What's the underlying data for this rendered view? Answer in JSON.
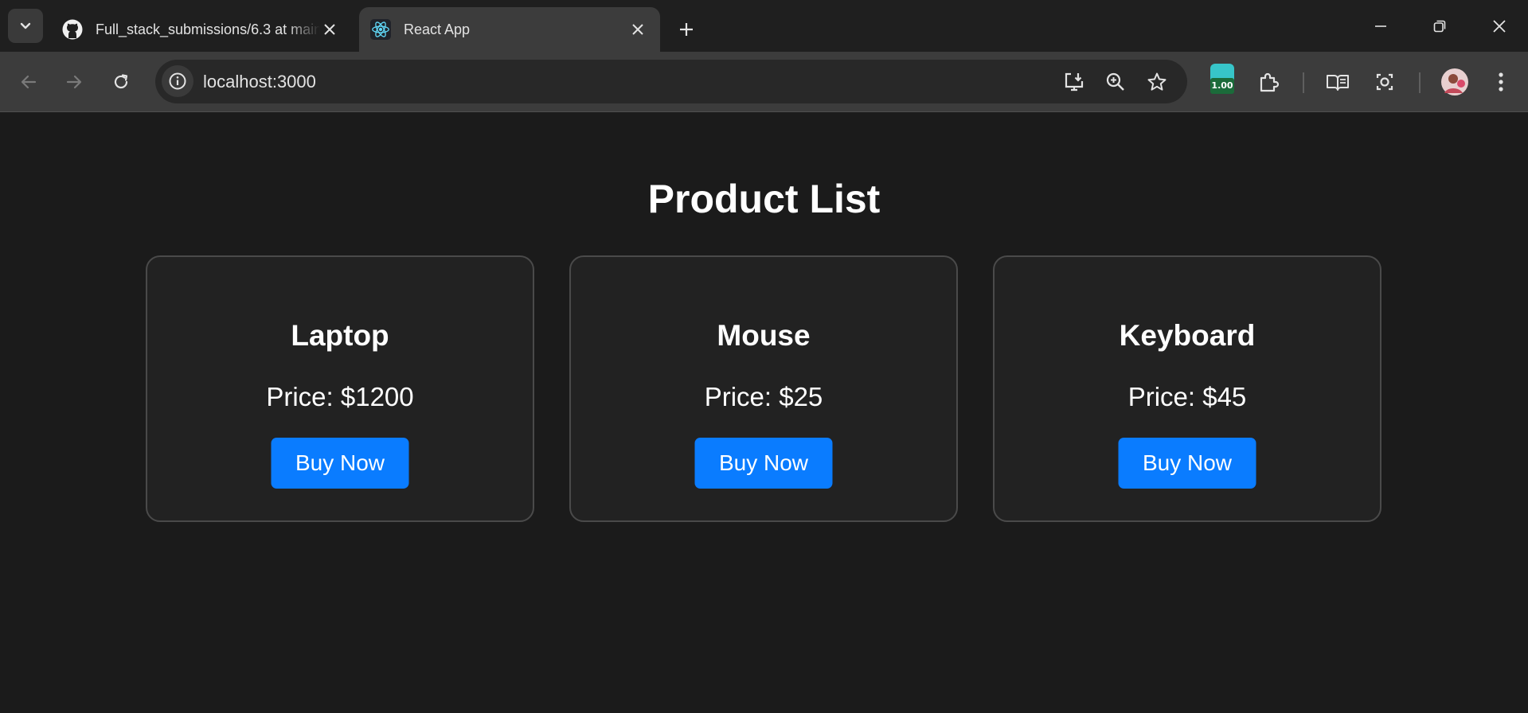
{
  "browser": {
    "tabs": [
      {
        "title": "Full_stack_submissions/6.3 at main",
        "favicon": "github-icon",
        "active": false
      },
      {
        "title": "React App",
        "favicon": "react-icon",
        "active": true
      }
    ],
    "address": "localhost:3000",
    "extension_badge": "1.00",
    "colors": {
      "tabstrip": "#1f1f1f",
      "toolbar": "#3c3c3c",
      "omnibox": "#282828"
    }
  },
  "page": {
    "title": "Product List",
    "products": [
      {
        "name": "Laptop",
        "price": "Price: $1200",
        "button": "Buy Now"
      },
      {
        "name": "Mouse",
        "price": "Price: $25",
        "button": "Buy Now"
      },
      {
        "name": "Keyboard",
        "price": "Price: $45",
        "button": "Buy Now"
      }
    ],
    "colors": {
      "background": "#1b1b1b",
      "card": "#222222",
      "button": "#0a7cff"
    }
  }
}
